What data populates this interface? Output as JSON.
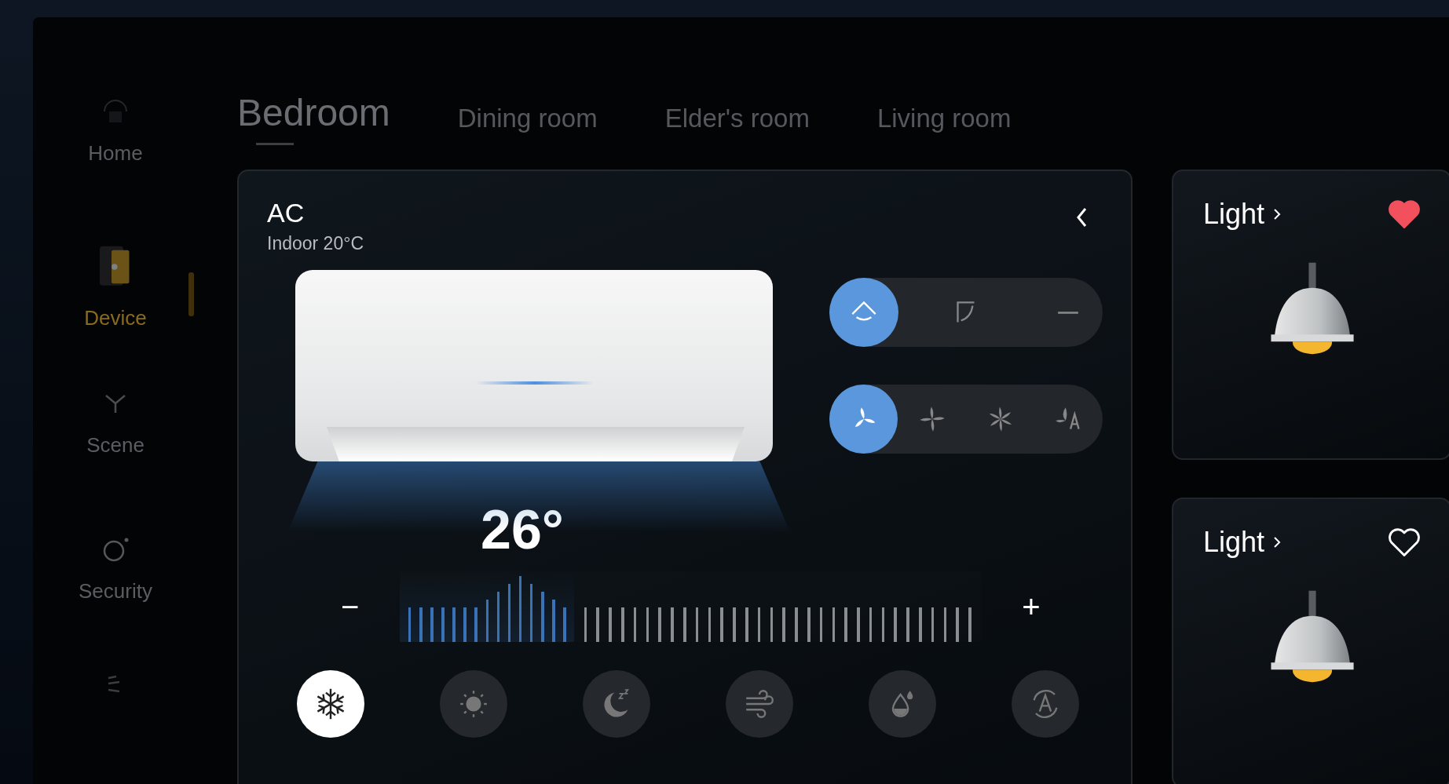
{
  "sidebar": {
    "items": [
      {
        "kind": "home",
        "label": "Home",
        "selected": false
      },
      {
        "kind": "device",
        "label": "Device",
        "selected": true
      },
      {
        "kind": "scene",
        "label": "Scene",
        "selected": false
      },
      {
        "kind": "security",
        "label": "Security",
        "selected": false
      }
    ]
  },
  "tabs": [
    {
      "label": "Bedroom",
      "selected": true
    },
    {
      "label": "Dining room",
      "selected": false
    },
    {
      "label": "Elder's room",
      "selected": false
    },
    {
      "label": "Living room",
      "selected": false
    }
  ],
  "ac": {
    "title": "AC",
    "subtitle": "Indoor 20°C",
    "temperature": "26°",
    "minus": "−",
    "plus": "+",
    "level": 0.3,
    "swing": [
      {
        "kind": "sweep",
        "selected": true
      },
      {
        "kind": "corner",
        "selected": false
      },
      {
        "kind": "fixed",
        "selected": false
      }
    ],
    "fan": [
      {
        "kind": "three-blade",
        "selected": true
      },
      {
        "kind": "four-blade",
        "selected": false
      },
      {
        "kind": "six-blade",
        "selected": false
      },
      {
        "kind": "auto",
        "selected": false
      }
    ],
    "modes": [
      {
        "kind": "cool",
        "selected": true
      },
      {
        "kind": "heat",
        "selected": false
      },
      {
        "kind": "sleep",
        "selected": false
      },
      {
        "kind": "wind",
        "selected": false
      },
      {
        "kind": "dry",
        "selected": false
      },
      {
        "kind": "auto",
        "selected": false
      }
    ]
  },
  "lights": [
    {
      "title": "Light",
      "favorite": true
    },
    {
      "title": "Light",
      "favorite": false
    }
  ]
}
